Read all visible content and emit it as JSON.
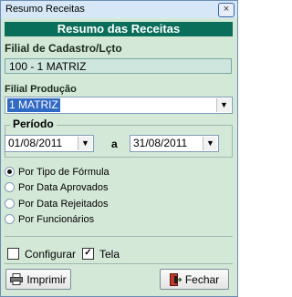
{
  "window": {
    "title": "Resumo Receitas",
    "close_glyph": "×"
  },
  "header": {
    "title": "Resumo das Receitas"
  },
  "filial_cadastro": {
    "label": "Filial de Cadastro/Lçto",
    "value": "100 - 1 MATRIZ"
  },
  "filial_producao": {
    "label": "Filial Produção",
    "selected": "1 MATRIZ"
  },
  "periodo": {
    "label": "Período",
    "start": "01/08/2011",
    "separator": "a",
    "end": "31/08/2011"
  },
  "radios": [
    {
      "label": "Por Tipo de Fórmula",
      "checked": true
    },
    {
      "label": "Por Data Aprovados",
      "checked": false
    },
    {
      "label": "Por Data Rejeitados",
      "checked": false
    },
    {
      "label": "Por Funcionários",
      "checked": false
    }
  ],
  "checks": {
    "configurar": {
      "label": "Configurar",
      "checked": false
    },
    "tela": {
      "label": "Tela",
      "checked": true,
      "mark": "✓"
    }
  },
  "buttons": {
    "imprimir": "Imprimir",
    "fechar": "Fechar"
  },
  "icons": {
    "dropdown": "▼",
    "printer": "printer-icon",
    "exit": "exit-door-icon"
  }
}
